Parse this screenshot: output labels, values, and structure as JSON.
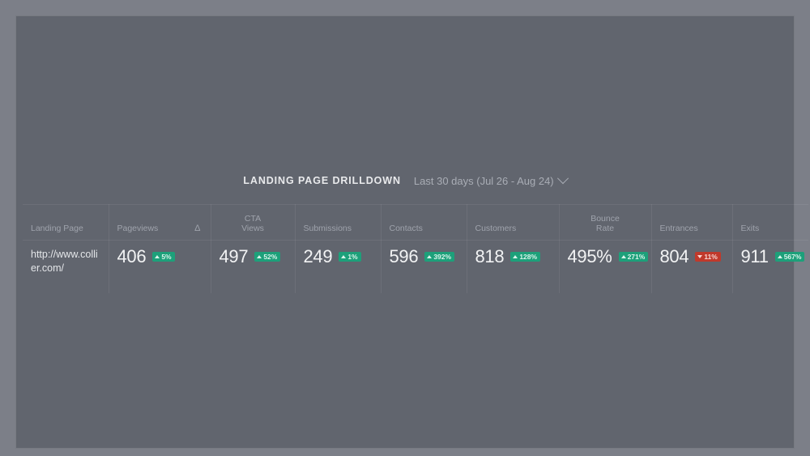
{
  "header": {
    "title": "LANDING PAGE DRILLDOWN",
    "date_range_label": "Last 30 days (Jul 26 - Aug 24)",
    "chevron_icon": "chevron-down-icon"
  },
  "colors": {
    "page_background": "#7c7f88",
    "panel_background": "#61656e",
    "badge_positive": "#1da07a",
    "badge_negative": "#c0392b",
    "value_text": "#f2f3f4",
    "header_text": "#9fa3ac"
  },
  "table": {
    "columns": [
      {
        "key": "landing_page",
        "label": "Landing Page",
        "sort_symbol": ""
      },
      {
        "key": "pageviews",
        "label": "Pageviews",
        "sort_symbol": "Δ"
      },
      {
        "key": "cta_views",
        "label_line1": "CTA",
        "label_line2": "Views"
      },
      {
        "key": "submissions",
        "label": "Submissions"
      },
      {
        "key": "contacts",
        "label": "Contacts"
      },
      {
        "key": "customers",
        "label": "Customers"
      },
      {
        "key": "bounce_rate",
        "label_line1": "Bounce",
        "label_line2": "Rate"
      },
      {
        "key": "entrances",
        "label": "Entrances"
      },
      {
        "key": "exits",
        "label": "Exits"
      }
    ],
    "rows": [
      {
        "landing_page": "http://www.collier.com/",
        "pageviews": {
          "value": "406",
          "delta": "5%",
          "direction": "up"
        },
        "cta_views": {
          "value": "497",
          "delta": "52%",
          "direction": "up"
        },
        "submissions": {
          "value": "249",
          "delta": "1%",
          "direction": "up"
        },
        "contacts": {
          "value": "596",
          "delta": "392%",
          "direction": "up"
        },
        "customers": {
          "value": "818",
          "delta": "128%",
          "direction": "up"
        },
        "bounce_rate": {
          "value": "495%",
          "delta": "271%",
          "direction": "up"
        },
        "entrances": {
          "value": "804",
          "delta": "11%",
          "direction": "down"
        },
        "exits": {
          "value": "911",
          "delta": "567%",
          "direction": "up"
        }
      }
    ]
  }
}
